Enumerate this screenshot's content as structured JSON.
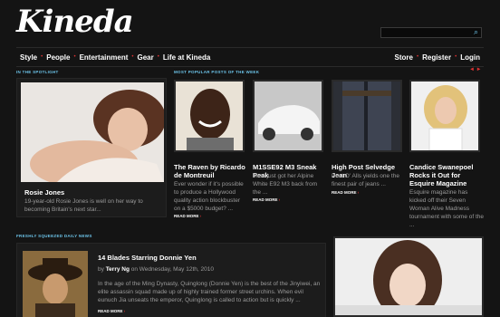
{
  "header": {
    "logo": "Kineda",
    "search_placeholder": ""
  },
  "nav": {
    "left": [
      "Style",
      "People",
      "Entertainment",
      "Gear",
      "Life at Kineda"
    ],
    "right": [
      "Store",
      "Register",
      "Login"
    ]
  },
  "spotlight": {
    "label": "IN THE SPOTLIGHT",
    "title": "Rosie Jones",
    "text": "19-year-old Rosie Jones is well on her way to becoming Britain's next star..."
  },
  "popular": {
    "label": "MOST POPULAR POSTS OF THE WEEK",
    "posts": [
      {
        "title": "The Raven by Ricardo de Montreuil",
        "text": "Ever wonder if it's possible to produce a Hollywood quality action blockbuster on a $5000 budget? ...",
        "read_more": "READ MORE"
      },
      {
        "title": "M1SSE92 M3 Sneak Peak",
        "text": "Tami just got her Alpine White E92 M3 back from the ...",
        "read_more": "READ MORE"
      },
      {
        "title": "High Post Selvedge Jean",
        "text": "Post O' Alls yields one the finest pair of jeans ...",
        "read_more": "READ MORE"
      },
      {
        "title": "Candice Swanepoel Rocks it Out for Esquire Magazine",
        "text": "Esquire magazine has kicked off their Seven Woman Alive Madness tournament with some of the ...",
        "read_more": ""
      }
    ]
  },
  "fresh": {
    "label": "FRESHLY SQUEEZED DAILY NEWS",
    "title": "14 Blades Starring Donnie Yen",
    "by": "by",
    "author": "Terry Ng",
    "date": "on Wednesday, May 12th, 2010",
    "text": "In the age of the Ming Dynasty, Quinglong (Donnie Yen) is the best of the Jinyiwei, an elite assassin squad made up of highly trained former street urchins. When evil eunuch Jia unseats the emperor, Quinglong is called to action but is quickly ...",
    "read_more": "READ MORE"
  },
  "colors": {
    "accent": "#6cc3e8",
    "bullet": "#dd3333"
  }
}
